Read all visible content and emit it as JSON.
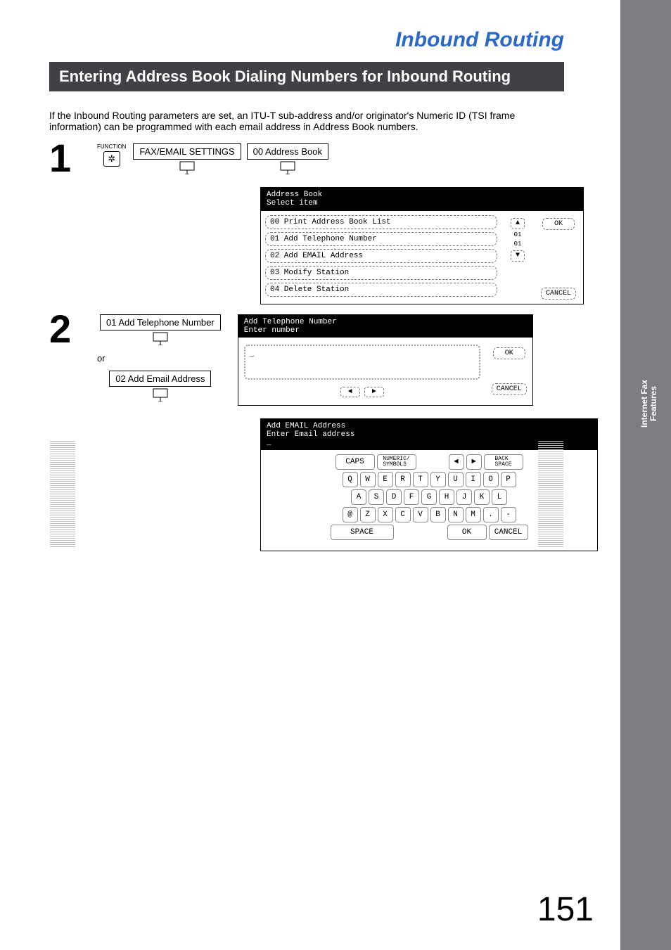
{
  "doc_title": "Inbound Routing",
  "section_heading": "Entering Address Book Dialing Numbers for Inbound Routing",
  "intro_text": "If the Inbound Routing parameters are set, an ITU-T sub-address and/or originator's Numeric ID (TSI frame information) can be programmed with each email address in Address Book numbers.",
  "side_tab": {
    "line1": "Internet Fax",
    "line2": "Features"
  },
  "page_number": "151",
  "step1": {
    "num": "1",
    "function_label": "FUNCTION",
    "function_key_glyph": "✲",
    "button1": "FAX/EMAIL SETTINGS",
    "button2": "00 Address Book"
  },
  "ab_screen": {
    "title_line1": "Address Book",
    "title_line2": "Select item",
    "items": [
      "00  Print Address Book List",
      "01  Add Telephone Number",
      "02  Add EMAIL Address",
      "03  Modify Station",
      "04  Delete Station"
    ],
    "ok": "OK",
    "cancel": "CANCEL",
    "page_top": "01",
    "page_bot": "01"
  },
  "step2": {
    "num": "2",
    "button_tel": "01 Add Telephone Number",
    "or": "or",
    "button_email": "02 Add Email Address"
  },
  "tel_screen": {
    "title_line1": "Add Telephone Number",
    "title_line2": "Enter number",
    "input_value": "_",
    "ok": "OK",
    "cancel": "CANCEL"
  },
  "email_screen": {
    "title_line1": "Add EMAIL Address",
    "title_line2": "Enter Email address",
    "cursor": "_",
    "caps": "CAPS",
    "numsym": "NUMERIC/\nSYMBOLS",
    "backspace": "BACK\nSPACE",
    "row1": [
      "Q",
      "W",
      "E",
      "R",
      "T",
      "Y",
      "U",
      "I",
      "O",
      "P"
    ],
    "row2": [
      "A",
      "S",
      "D",
      "F",
      "G",
      "H",
      "J",
      "K",
      "L"
    ],
    "row3": [
      "@",
      "Z",
      "X",
      "C",
      "V",
      "B",
      "N",
      "M",
      ".",
      "-"
    ],
    "space": "SPACE",
    "ok": "OK",
    "cancel": "CANCEL",
    "arrow_left": "◄",
    "arrow_right": "►"
  }
}
